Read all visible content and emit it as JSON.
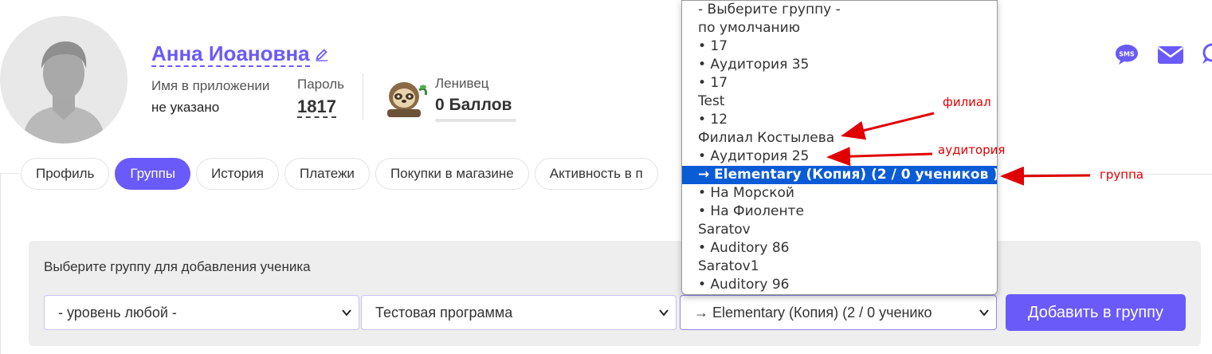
{
  "profile": {
    "name": "Анна Иоановна",
    "app_name_label": "Имя в приложении",
    "app_name_value": "не указано",
    "password_label": "Пароль",
    "password_value": "1817",
    "level_label": "Ленивец",
    "level_points": "0 Баллов"
  },
  "contact_icons": [
    "sms-icon",
    "mail-icon",
    "chat-icon"
  ],
  "tabs": [
    {
      "label": "Профиль",
      "active": false
    },
    {
      "label": "Группы",
      "active": true
    },
    {
      "label": "История",
      "active": false
    },
    {
      "label": "Платежи",
      "active": false
    },
    {
      "label": "Покупки в магазине",
      "active": false
    },
    {
      "label": "Активность в п",
      "active": false
    }
  ],
  "add_group": {
    "title": "Выберите группу для добавления ученика",
    "level_select": "- уровень любой -",
    "program_select": "Тестовая программа",
    "group_select": "→ Elementary (Копия) (2 / 0 ученико",
    "add_button": "Добавить в группу"
  },
  "group_dropdown": {
    "options": [
      "- Выберите группу -",
      "по умолчанию",
      "• 17",
      "• Аудитория 35",
      "• 17",
      "Test",
      "• 12",
      "Филиал Костылева",
      "• Аудитория 25",
      "→ Elementary (Копия) (2 / 0 учеников )",
      "• На Морской",
      "• На Фиоленте",
      "Saratov",
      "• Auditory 86",
      "Saratov1",
      "• Auditory 96"
    ],
    "selected_index": 9
  },
  "annotations": {
    "branch": "филиал",
    "auditorium": "аудитория",
    "group": "группа"
  },
  "colors": {
    "accent": "#6a5af9",
    "selected_option": "#0a5bd6",
    "annotation": "#e00000"
  }
}
